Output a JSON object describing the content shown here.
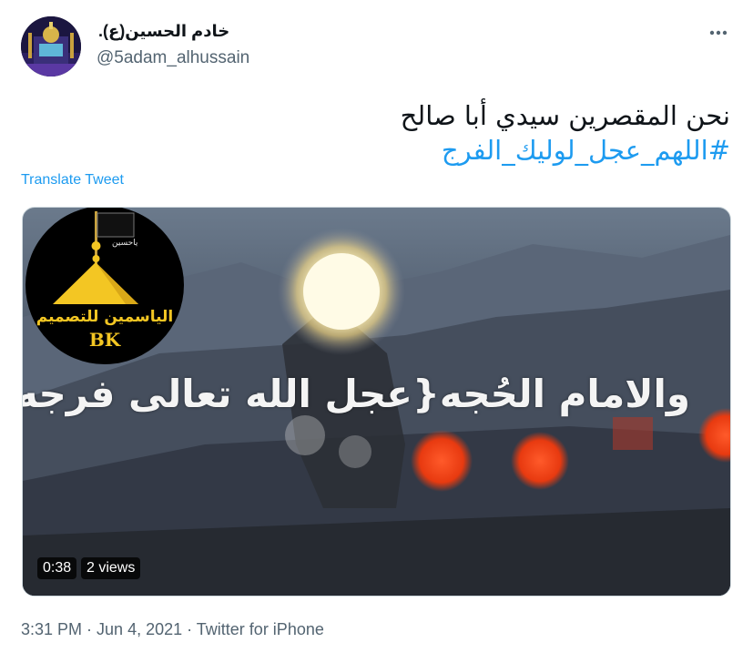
{
  "author": {
    "display_name": "خادم الحسين(ع).",
    "handle": "@5adam_alhussain",
    "avatar_icon": "shrine-avatar"
  },
  "more_icon": "more-horizontal-icon",
  "tweet": {
    "text_line1": "نحن المقصرين سيدي أبا صالح",
    "hashtag": "#اللهم_عجل_لوليك_الفرج"
  },
  "translate_label": "Translate Tweet",
  "media": {
    "overlay_text": "والامام الحُجه{عجل الله تعالى فرجه}",
    "logo_text": "الياسمين للتصميم",
    "logo_bk": "BK",
    "logo_flag_text": "ياحسين",
    "duration": "0:38",
    "views": "2 views"
  },
  "meta": {
    "time": "3:31 PM",
    "separator": " · ",
    "date": "Jun 4, 2021",
    "source": "Twitter for iPhone"
  },
  "colors": {
    "link": "#1d9bf0",
    "secondary": "#536471",
    "text": "#0f1419"
  }
}
